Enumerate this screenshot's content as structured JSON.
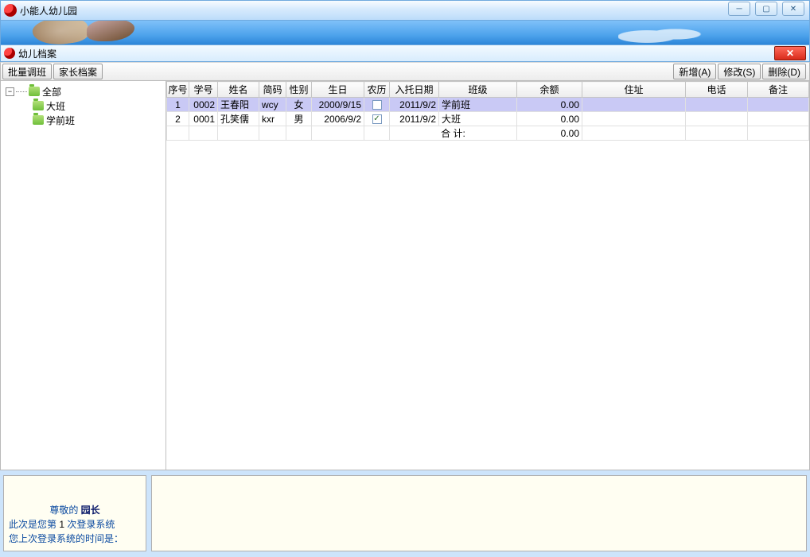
{
  "window": {
    "title": "小能人幼儿园"
  },
  "panel": {
    "title": "幼儿档案"
  },
  "toolbar": {
    "batch_adjust": "批量调班",
    "parent_profile": "家长档案",
    "add": "新增(A)",
    "edit": "修改(S)",
    "delete": "删除(D)"
  },
  "tree": {
    "root": "全部",
    "items": [
      "大班",
      "学前班"
    ]
  },
  "grid": {
    "headers": {
      "seq": "序号",
      "sid": "学号",
      "name": "姓名",
      "pinyin": "简码",
      "gender": "性别",
      "bday": "生日",
      "lunar": "农历",
      "enroll": "入托日期",
      "class": "班级",
      "balance": "余额",
      "address": "住址",
      "phone": "电话",
      "remark": "备注"
    },
    "rows": [
      {
        "seq": "1",
        "sid": "0002",
        "name": "王春阳",
        "pinyin": "wcy",
        "gender": "女",
        "bday": "2000/9/15",
        "lunar": false,
        "enroll": "2011/9/2",
        "class": "学前班",
        "balance": "0.00",
        "address": "",
        "phone": "",
        "remark": ""
      },
      {
        "seq": "2",
        "sid": "0001",
        "name": "孔笑儒",
        "pinyin": "kxr",
        "gender": "男",
        "bday": "2006/9/2",
        "lunar": true,
        "enroll": "2011/9/2",
        "class": "大班",
        "balance": "0.00",
        "address": "",
        "phone": "",
        "remark": ""
      }
    ],
    "summary": {
      "label": "合  计:",
      "balance": "0.00"
    }
  },
  "footer": {
    "line1_a": "尊敬的 ",
    "line1_b": "园长",
    "line2_a": "此次是您第  ",
    "line2_count": "1",
    "line2_b": "  次登录系统",
    "line3": "您上次登录系统的时间是："
  },
  "glyph": {
    "minimize": "─",
    "maximize": "▢",
    "close": "✕",
    "collapse": "−"
  }
}
